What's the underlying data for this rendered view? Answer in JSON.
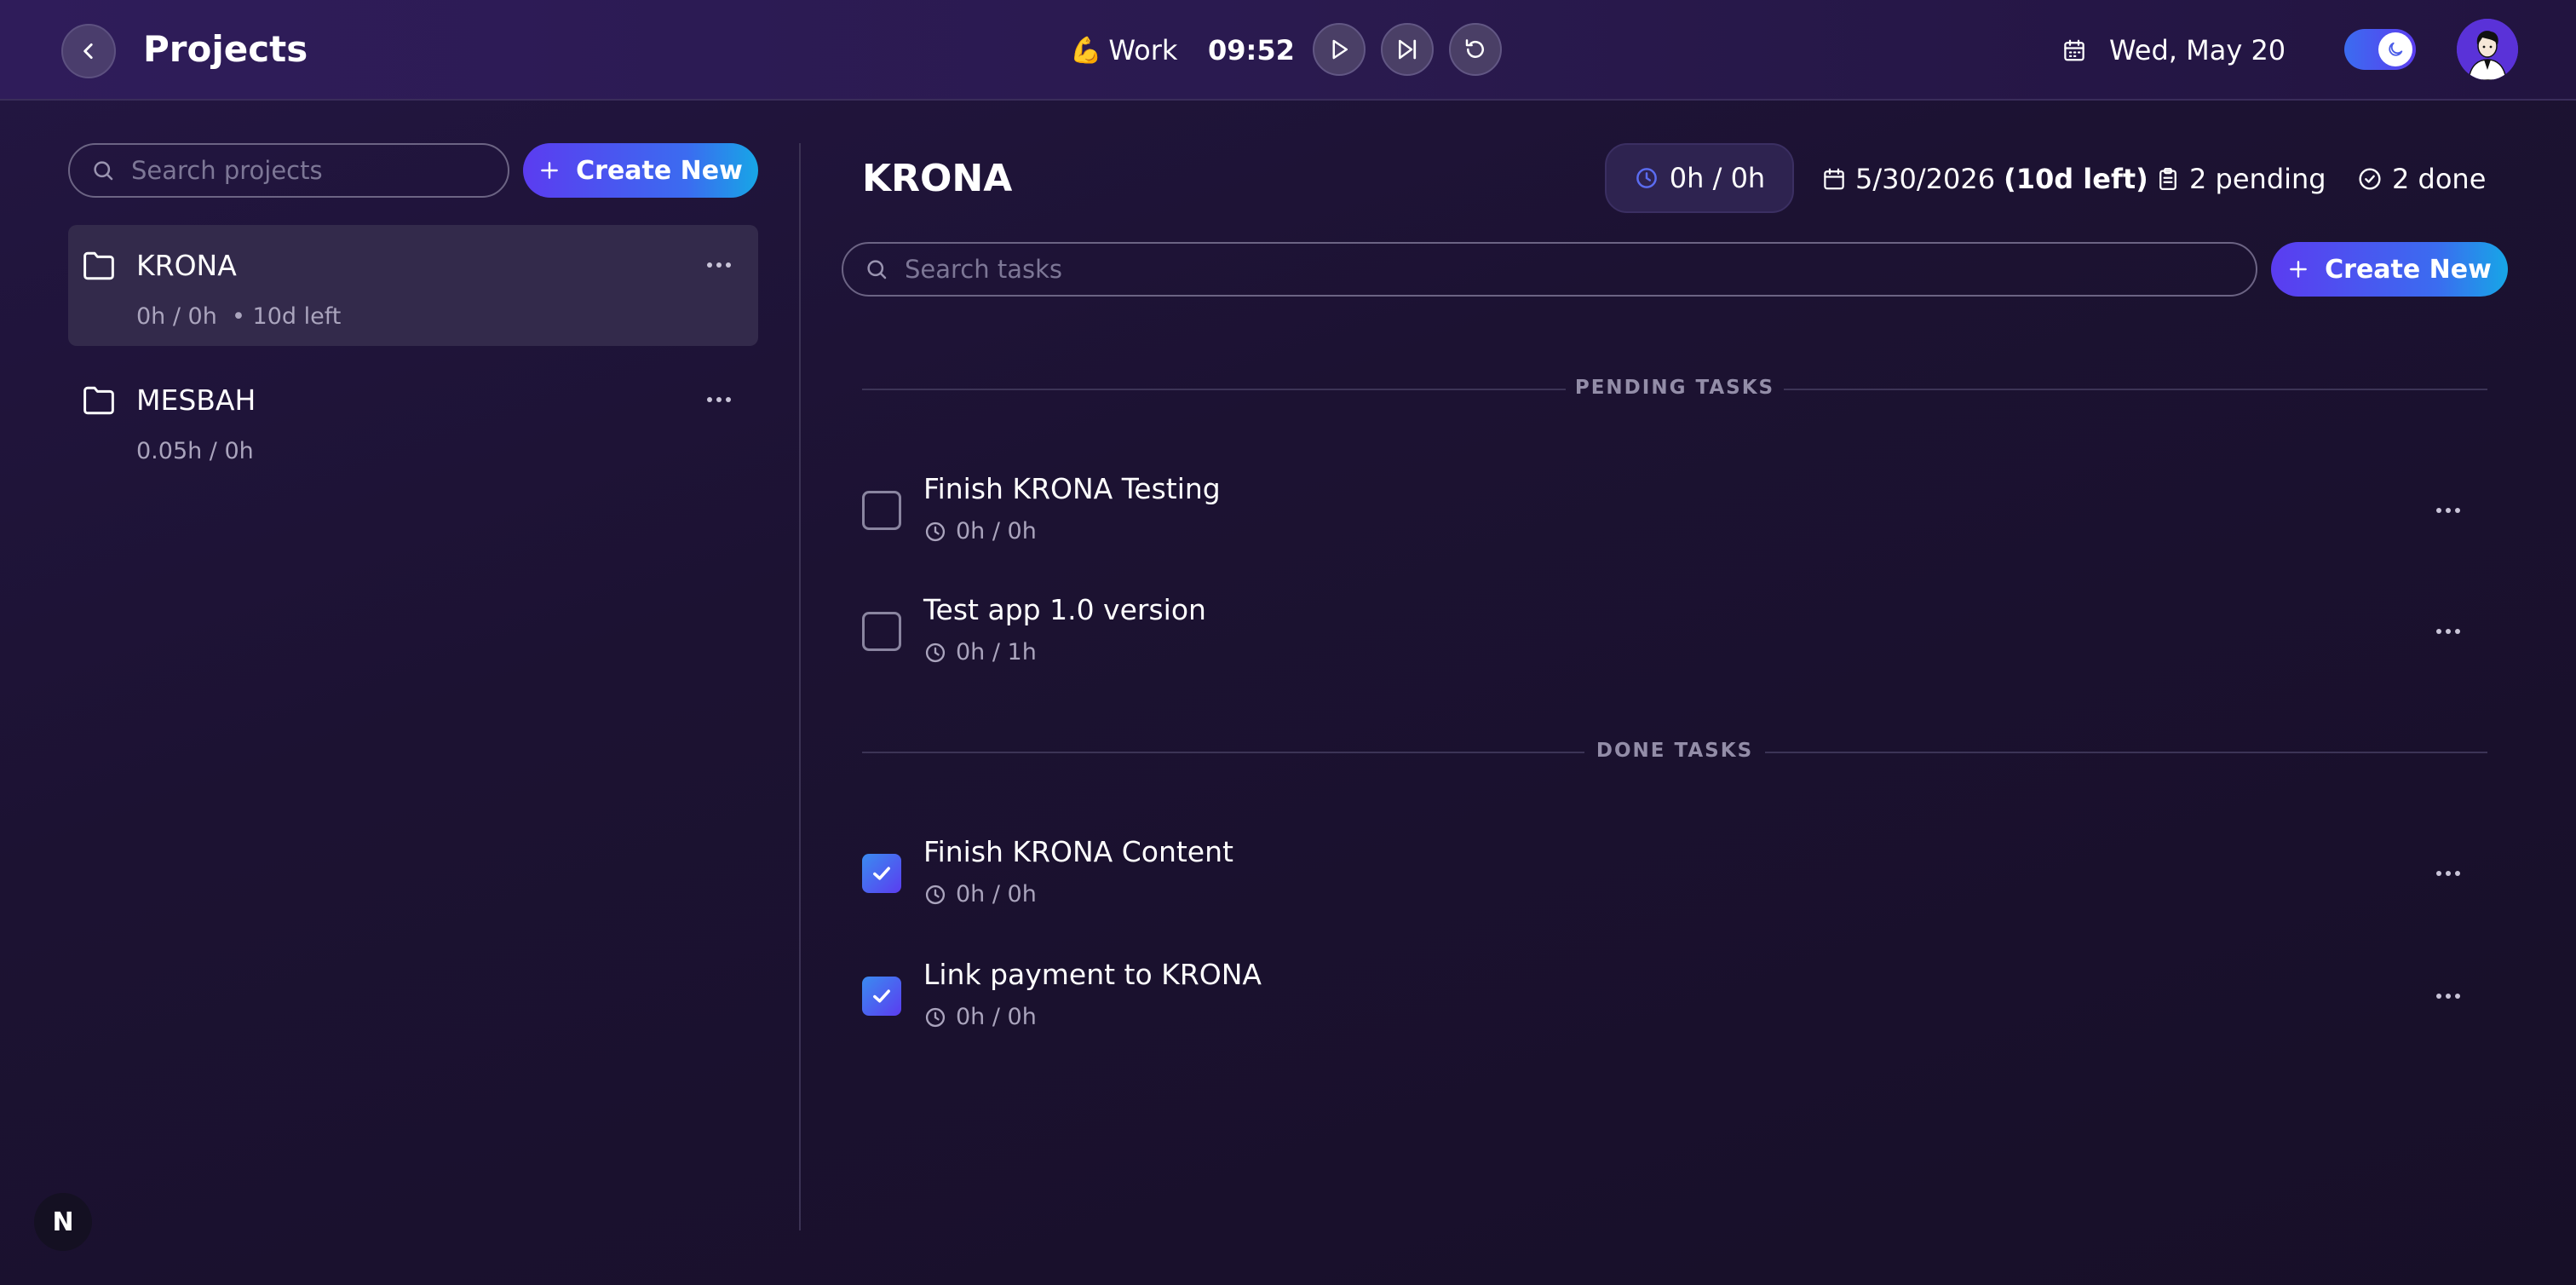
{
  "header": {
    "title": "Projects",
    "mode_emoji": "💪",
    "mode_label": "Work",
    "timer": "09:52",
    "date": "Wed, May 20",
    "dark_mode": true
  },
  "sidebar": {
    "search_placeholder": "Search projects",
    "create_label": "Create New",
    "projects": [
      {
        "name": "KRONA",
        "meta": "0h / 0h  • 10d left",
        "active": true
      },
      {
        "name": "MESBAH",
        "meta": "0.05h / 0h",
        "active": false
      }
    ]
  },
  "main": {
    "project_title": "KRONA",
    "hours": "0h / 0h",
    "deadline": "5/30/2026",
    "deadline_left": "(10d left)",
    "pending_count": "2 pending",
    "done_count": "2 done",
    "search_placeholder": "Search tasks",
    "create_label": "Create New",
    "pending_heading": "PENDING TASKS",
    "done_heading": "DONE TASKS",
    "pending_tasks": [
      {
        "title": "Finish KRONA Testing",
        "time": "0h / 0h"
      },
      {
        "title": "Test app 1.0 version",
        "time": "0h / 1h"
      }
    ],
    "done_tasks": [
      {
        "title": "Finish KRONA Content",
        "time": "0h / 0h"
      },
      {
        "title": "Link payment to KRONA",
        "time": "0h / 0h"
      }
    ]
  },
  "dev_badge": "N",
  "colors": {
    "accent_start": "#5b3cf0",
    "accent_end": "#17a6e6",
    "background": "#1c1232"
  }
}
